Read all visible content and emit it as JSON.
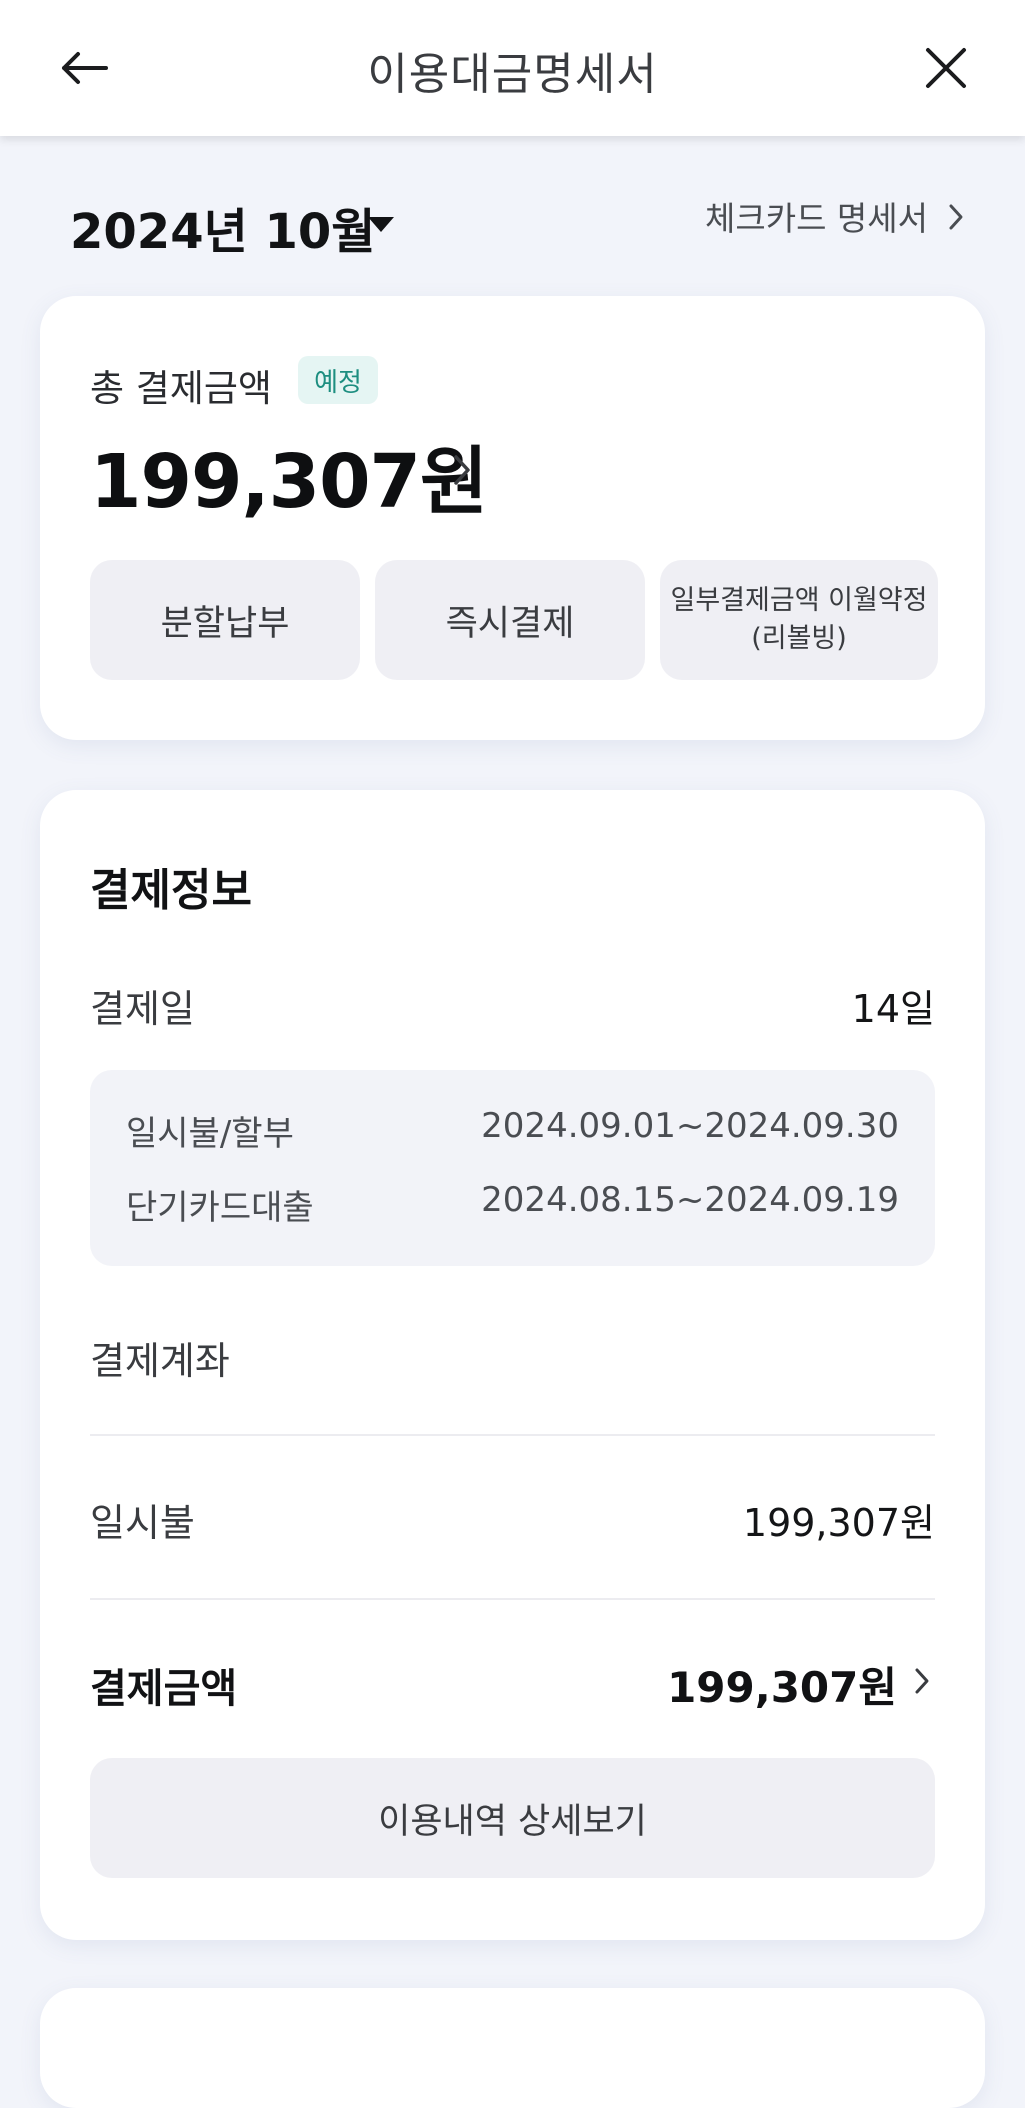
{
  "header": {
    "title": "이용대금명세서",
    "back_icon": "arrow-left-icon",
    "close_icon": "close-icon"
  },
  "month_selector": {
    "label": "2024년 10월",
    "caret_icon": "caret-down-icon",
    "check_card_link": "체크카드 명세서"
  },
  "summary": {
    "total_label": "총 결제금액",
    "badge": "예정",
    "amount": "199,307원",
    "actions": {
      "installment": "분할납부",
      "instant_pay": "즉시결제",
      "revolving_line1": "일부결제금액 이월약정",
      "revolving_line2": "(리볼빙)"
    }
  },
  "payment_info": {
    "title": "결제정보",
    "pay_day_label": "결제일",
    "pay_day_value": "14일",
    "periods": [
      {
        "label": "일시불/할부",
        "value": "2024.09.01~2024.09.30"
      },
      {
        "label": "단기카드대출",
        "value": "2024.08.15~2024.09.19"
      }
    ],
    "account_label": "결제계좌",
    "account_value": "",
    "lump_sum_label": "일시불",
    "lump_sum_value": "199,307원",
    "pay_amount_label": "결제금액",
    "pay_amount_value": "199,307원",
    "detail_button": "이용내역 상세보기"
  },
  "colors": {
    "background": "#f2f4fa",
    "card": "#ffffff",
    "badge_bg": "#e5f5f3",
    "badge_text": "#1d8e80",
    "button_bg": "#efeff4"
  }
}
